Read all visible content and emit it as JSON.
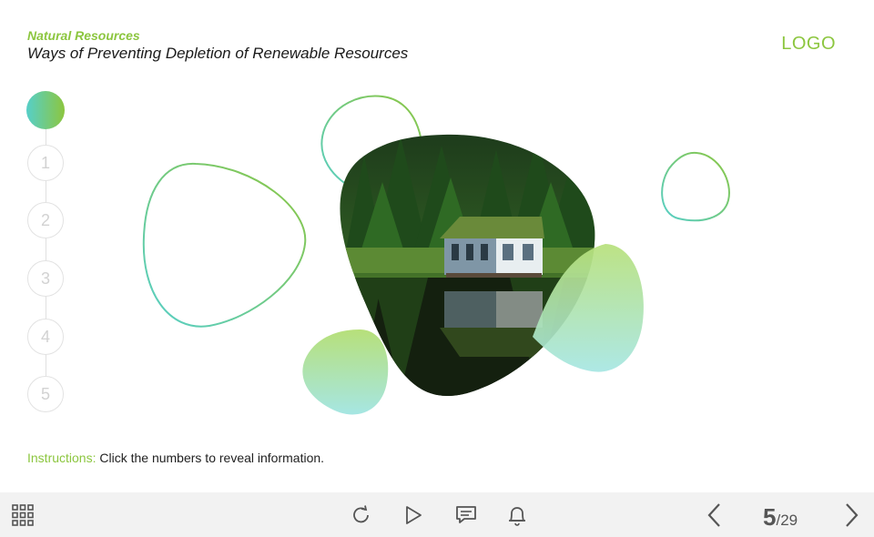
{
  "header": {
    "category": "Natural Resources",
    "title": "Ways of Preventing Depletion of Renewable Resources",
    "logo": "LOGO"
  },
  "steps": [
    {
      "label": "",
      "active": true
    },
    {
      "label": "1",
      "active": false
    },
    {
      "label": "2",
      "active": false
    },
    {
      "label": "3",
      "active": false
    },
    {
      "label": "4",
      "active": false
    },
    {
      "label": "5",
      "active": false
    }
  ],
  "instructions": {
    "label": "Instructions:",
    "text": "Click the numbers to reveal information."
  },
  "toolbar": {
    "menu_icon": "grid-menu-icon",
    "replay_icon": "replay-icon",
    "play_icon": "play-icon",
    "notes_icon": "notes-icon",
    "bell_icon": "bell-icon",
    "prev_icon": "chevron-left-icon",
    "next_icon": "chevron-right-icon"
  },
  "pager": {
    "current": "5",
    "total": "/29"
  },
  "colors": {
    "accent_green": "#8cc63f",
    "accent_teal": "#56cfc9",
    "toolbar_bg": "#f2f2f2"
  }
}
